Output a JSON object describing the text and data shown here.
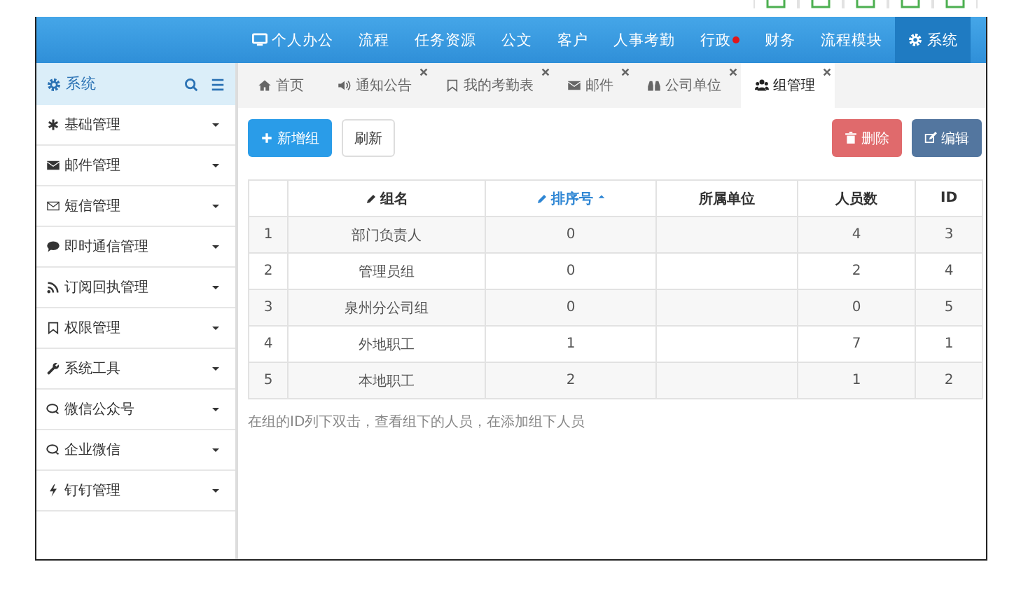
{
  "nav": [
    {
      "label": "个人办公",
      "selected": false,
      "alert": false
    },
    {
      "label": "流程",
      "selected": false,
      "alert": false
    },
    {
      "label": "任务资源",
      "selected": false,
      "alert": false
    },
    {
      "label": "公文",
      "selected": false,
      "alert": false
    },
    {
      "label": "客户",
      "selected": false,
      "alert": false
    },
    {
      "label": "人事考勤",
      "selected": false,
      "alert": false
    },
    {
      "label": "行政",
      "selected": false,
      "alert": true
    },
    {
      "label": "财务",
      "selected": false,
      "alert": false
    },
    {
      "label": "流程模块",
      "selected": false,
      "alert": false
    },
    {
      "label": "系统",
      "selected": true,
      "alert": false
    }
  ],
  "sidebar": {
    "title": "系统",
    "items": [
      {
        "label": "基础管理",
        "expanded": false
      },
      {
        "label": "邮件管理",
        "expanded": false
      },
      {
        "label": "短信管理",
        "expanded": false
      },
      {
        "label": "即时通信管理",
        "expanded": false
      },
      {
        "label": "订阅回执管理",
        "expanded": false
      },
      {
        "label": "权限管理",
        "expanded": false
      },
      {
        "label": "系统工具",
        "expanded": false
      },
      {
        "label": "微信公众号",
        "expanded": false
      },
      {
        "label": "企业微信",
        "expanded": false
      },
      {
        "label": "钉钉管理",
        "expanded": false
      }
    ]
  },
  "tabs": [
    {
      "label": "首页",
      "selected": false,
      "closable": false
    },
    {
      "label": "通知公告",
      "selected": false,
      "closable": true
    },
    {
      "label": "我的考勤表",
      "selected": false,
      "closable": true
    },
    {
      "label": "邮件",
      "selected": false,
      "closable": true
    },
    {
      "label": "公司单位",
      "selected": false,
      "closable": true
    },
    {
      "label": "组管理",
      "selected": true,
      "closable": true
    }
  ],
  "toolbar": {
    "add": "新增组",
    "refresh": "刷新",
    "delete": "删除",
    "edit": "编辑"
  },
  "table": {
    "columns": [
      {
        "label": "组名",
        "editable": true,
        "sorted": false
      },
      {
        "label": "排序号",
        "editable": true,
        "sorted": true
      },
      {
        "label": "所属单位",
        "editable": false,
        "sorted": false
      },
      {
        "label": "人员数",
        "editable": false,
        "sorted": false
      },
      {
        "label": "ID",
        "editable": false,
        "sorted": false
      }
    ],
    "rows": [
      {
        "index": "1",
        "cells": [
          "部门负责人",
          "0",
          "",
          "4",
          "3"
        ]
      },
      {
        "index": "2",
        "cells": [
          "管理员组",
          "0",
          "",
          "2",
          "4"
        ]
      },
      {
        "index": "3",
        "cells": [
          "泉州分公司组",
          "0",
          "",
          "0",
          "5"
        ]
      },
      {
        "index": "4",
        "cells": [
          "外地职工",
          "1",
          "",
          "7",
          "1"
        ]
      },
      {
        "index": "5",
        "cells": [
          "本地职工",
          "2",
          "",
          "1",
          "2"
        ]
      }
    ]
  },
  "note": "在组的ID列下双击，查看组下的人员，在添加组下人员"
}
